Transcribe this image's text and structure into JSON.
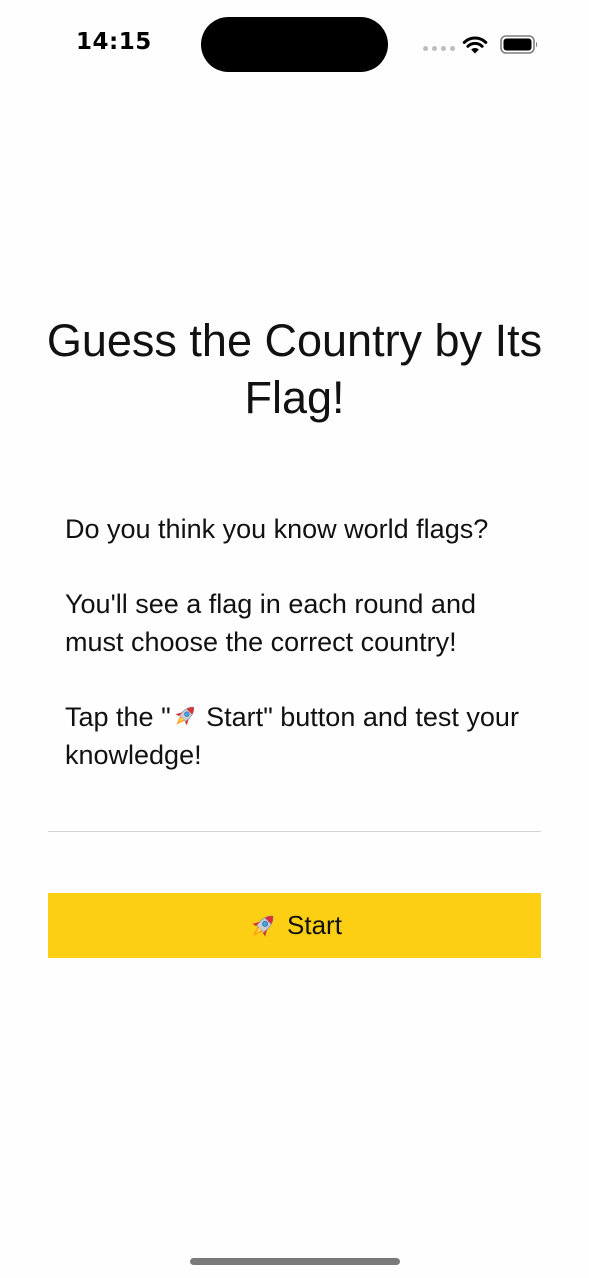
{
  "status_bar": {
    "time": "14:15"
  },
  "title": "Guess the Country by Its Flag!",
  "intro": {
    "line1": "Do you think you know world flags?",
    "line2": "You'll see a flag in each round and must choose the correct country!",
    "line3_prefix": "Tap the \"",
    "line3_button_ref": " Start",
    "line3_suffix": "\" button and test your knowledge!"
  },
  "start_button": {
    "label": "Start",
    "icon": "rocket-icon"
  },
  "colors": {
    "accent": "#fccf14",
    "background": "#fefefe",
    "text": "#111111"
  }
}
